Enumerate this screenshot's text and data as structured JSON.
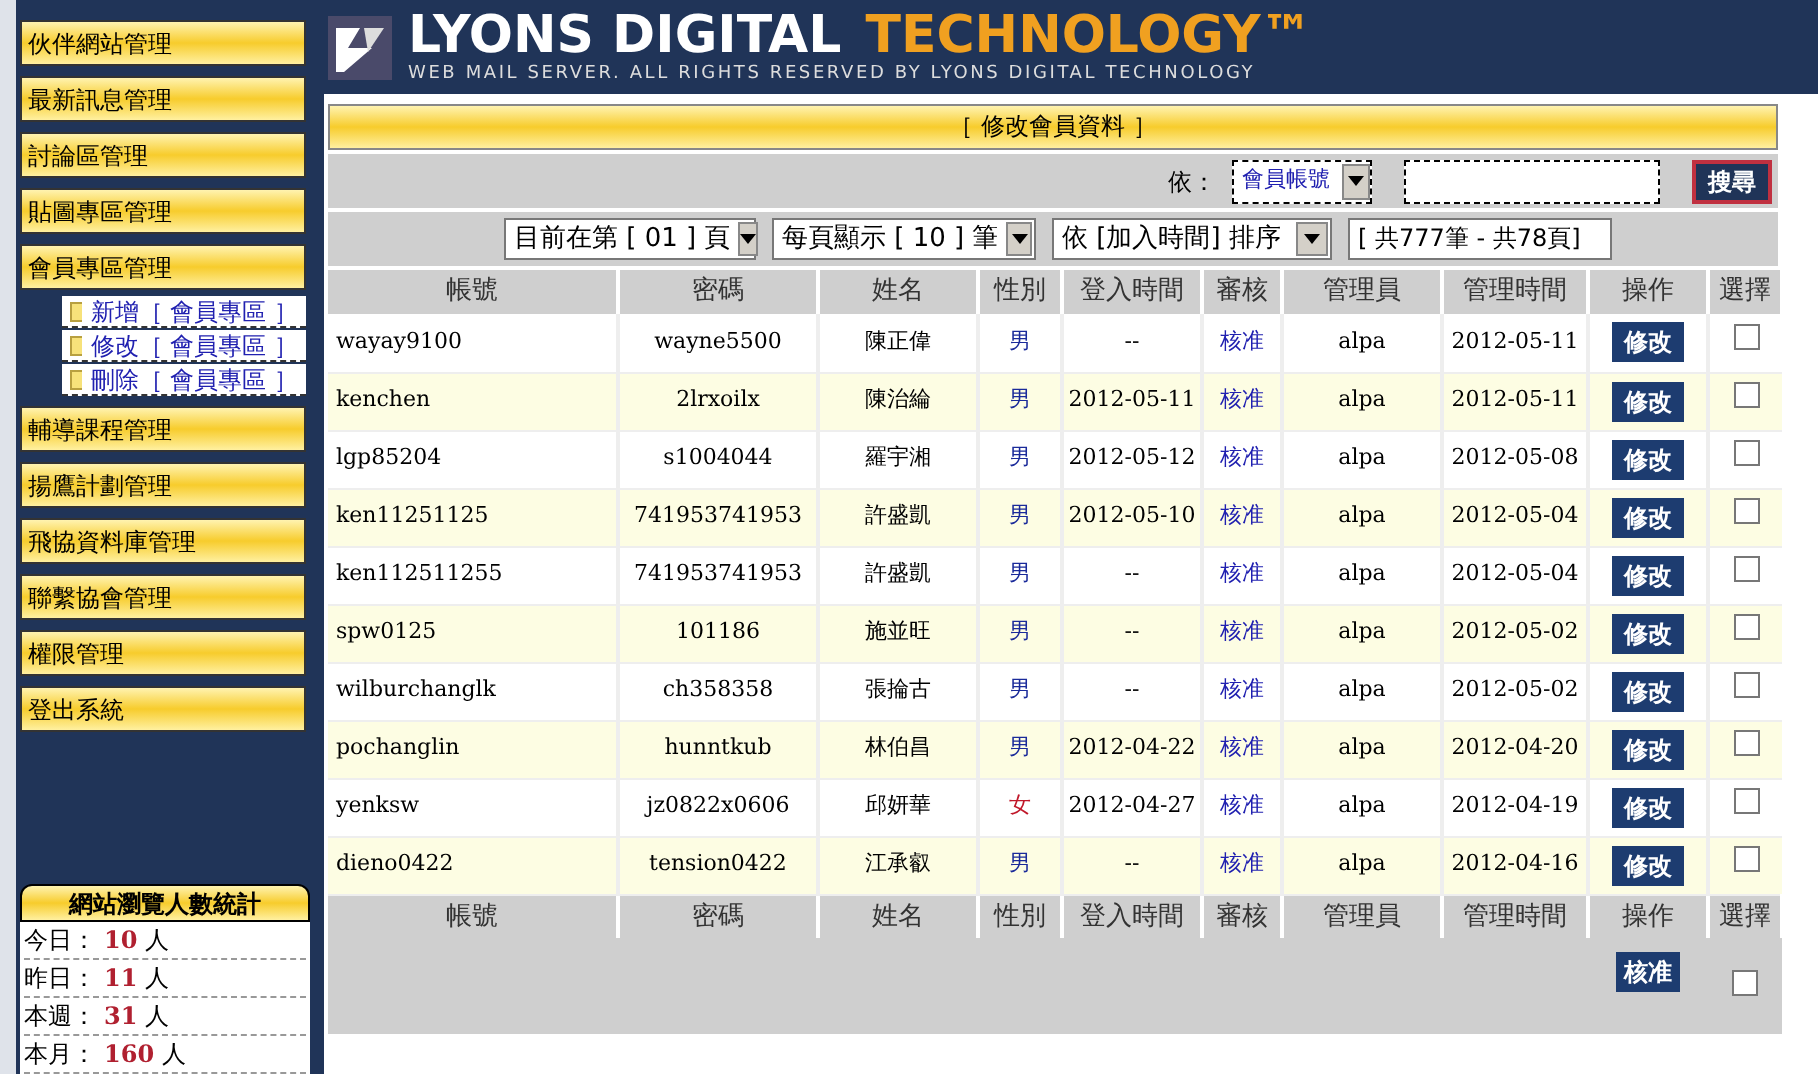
{
  "header": {
    "title_white": "LYONS DIGITAL",
    "title_orange": "TECHNOLOGY™",
    "subtitle": "WEB MAIL SERVER. ALL RIGHTS RESERVED BY LYONS DIGITAL TECHNOLOGY"
  },
  "sidebar": {
    "items": [
      {
        "label": "伙伴網站管理"
      },
      {
        "label": "最新訊息管理"
      },
      {
        "label": "討論區管理"
      },
      {
        "label": "貼圖專區管理"
      },
      {
        "label": "會員專區管理",
        "children": [
          {
            "label": "新增［ 會員專區 ］"
          },
          {
            "label": "修改［ 會員專區 ］"
          },
          {
            "label": "刪除［ 會員專區 ］"
          }
        ]
      },
      {
        "label": "輔導課程管理"
      },
      {
        "label": "揚鷹計劃管理"
      },
      {
        "label": "飛協資料庫管理"
      },
      {
        "label": "聯繫協會管理"
      },
      {
        "label": "權限管理"
      },
      {
        "label": "登出系統"
      }
    ]
  },
  "stats": {
    "title": "網站瀏覽人數統計",
    "rows": [
      {
        "label": "今日：",
        "count": "10",
        "unit": "人"
      },
      {
        "label": "昨日：",
        "count": "11",
        "unit": "人"
      },
      {
        "label": "本週：",
        "count": "31",
        "unit": "人"
      },
      {
        "label": "本月：",
        "count": "160",
        "unit": "人"
      }
    ]
  },
  "panel_title": "［ 修改會員資料 ］",
  "search": {
    "label": "依：",
    "field_select": "會員帳號",
    "button": "搜尋"
  },
  "pager": {
    "page": "目前在第 [ 01 ] 頁",
    "per_page": "每頁顯示 [ 10 ] 筆",
    "sort": "依 [加入時間] 排序",
    "total": "[ 共777筆 - 共78頁]"
  },
  "table": {
    "columns": [
      "帳號",
      "密碼",
      "姓名",
      "性別",
      "登入時間",
      "審核",
      "管理員",
      "管理時間",
      "操作",
      "選擇"
    ],
    "rows": [
      {
        "account": "wayay9100",
        "password": "wayne5500",
        "name": "陳正偉",
        "gender": "男",
        "color": "#1a2a9a",
        "login": "--",
        "review": "核准",
        "admin": "alpa",
        "admin_time": "2012-05-11",
        "action": "修改",
        "checked": false
      },
      {
        "account": "kenchen",
        "password": "2lrxoilx",
        "name": "陳治綸",
        "gender": "男",
        "color": "#1a2a9a",
        "login": "2012-05-11",
        "review": "核准",
        "admin": "alpa",
        "admin_time": "2012-05-11",
        "action": "修改",
        "checked": false
      },
      {
        "account": "lgp85204",
        "password": "s1004044",
        "name": "羅宇湘",
        "gender": "男",
        "color": "#1a2a9a",
        "login": "2012-05-12",
        "review": "核准",
        "admin": "alpa",
        "admin_time": "2012-05-08",
        "action": "修改",
        "checked": false
      },
      {
        "account": "ken11251125",
        "password": "741953741953",
        "name": "許盛凱",
        "gender": "男",
        "color": "#1a2a9a",
        "login": "2012-05-10",
        "review": "核准",
        "admin": "alpa",
        "admin_time": "2012-05-04",
        "action": "修改",
        "checked": false
      },
      {
        "account": "ken112511255",
        "password": "741953741953",
        "name": "許盛凱",
        "gender": "男",
        "color": "#1a2a9a",
        "login": "--",
        "review": "核准",
        "admin": "alpa",
        "admin_time": "2012-05-04",
        "action": "修改",
        "checked": false
      },
      {
        "account": "spw0125",
        "password": "101186",
        "name": "施並旺",
        "gender": "男",
        "color": "#1a2a9a",
        "login": "--",
        "review": "核准",
        "admin": "alpa",
        "admin_time": "2012-05-02",
        "action": "修改",
        "checked": false
      },
      {
        "account": "wilburchanglk",
        "password": "ch358358",
        "name": "張掄古",
        "gender": "男",
        "color": "#1a2a9a",
        "login": "--",
        "review": "核准",
        "admin": "alpa",
        "admin_time": "2012-05-02",
        "action": "修改",
        "checked": false
      },
      {
        "account": "pochanglin",
        "password": "hunntkub",
        "name": "林伯昌",
        "gender": "男",
        "color": "#1a2a9a",
        "login": "2012-04-22",
        "review": "核准",
        "admin": "alpa",
        "admin_time": "2012-04-20",
        "action": "修改",
        "checked": false
      },
      {
        "account": "yenksw",
        "password": "jz0822x0606",
        "name": "邱妍華",
        "gender": "女",
        "color": "#c0182a",
        "login": "2012-04-27",
        "review": "核准",
        "admin": "alpa",
        "admin_time": "2012-04-19",
        "action": "修改",
        "checked": false
      },
      {
        "account": "dieno0422",
        "password": "tension0422",
        "name": "江承叡",
        "gender": "男",
        "color": "#1a2a9a",
        "login": "--",
        "review": "核准",
        "admin": "alpa",
        "admin_time": "2012-04-16",
        "action": "修改",
        "checked": false
      }
    ],
    "footer_columns": [
      "帳號",
      "密碼",
      "姓名",
      "性別",
      "登入時間",
      "審核",
      "管理員",
      "管理時間",
      "操作",
      "選擇"
    ],
    "bulk_button": "核准",
    "bulk_checked": false
  }
}
